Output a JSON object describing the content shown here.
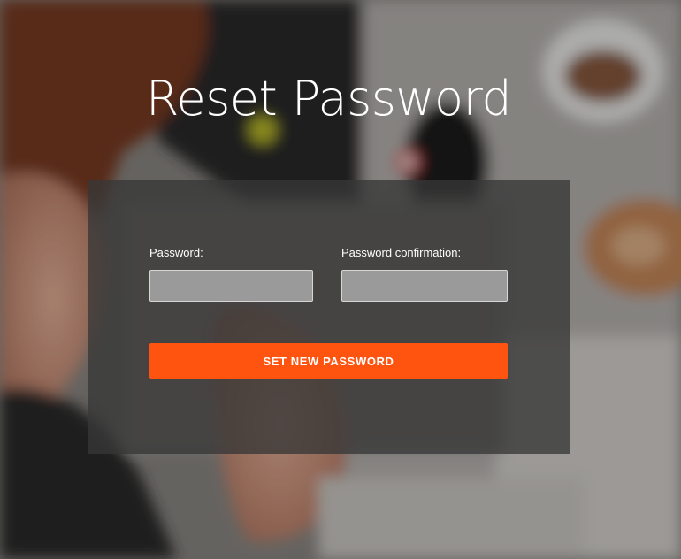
{
  "title": "Reset Password",
  "form": {
    "password_label": "Password:",
    "password_value": "",
    "confirmation_label": "Password confirmation:",
    "confirmation_value": "",
    "submit_label": "SET NEW PASSWORD"
  },
  "colors": {
    "accent": "#ff5310",
    "panel": "#373737",
    "input_bg": "#9a9a9a",
    "title": "#ffffff"
  }
}
